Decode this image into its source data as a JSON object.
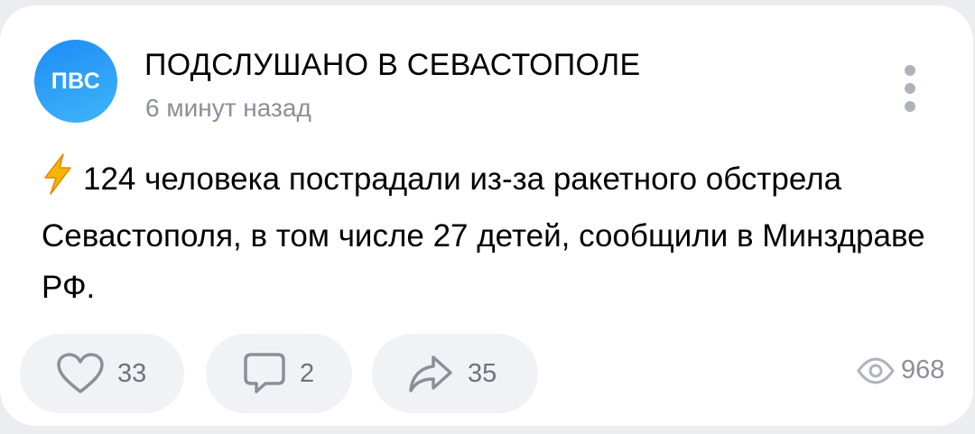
{
  "post": {
    "avatar_text": "ПВС",
    "author": "ПОДСЛУШАНО В СЕВАСТОПОЛЕ",
    "time": "6 минут назад",
    "text": "124 человека пострадали из-за ракетного обстрела Севастополя, в том числе 27 детей, сообщили в Минздраве РФ.",
    "leading_emoji_icon": "lightning-bolt-icon"
  },
  "actions": {
    "likes": "33",
    "comments": "2",
    "shares": "35",
    "views": "968"
  },
  "colors": {
    "avatar_gradient_start": "#1e8bf5",
    "avatar_gradient_end": "#3fb6f9",
    "muted_text": "#8a9099",
    "action_bg": "#f0f2f5",
    "bolt": "#f7b500"
  }
}
